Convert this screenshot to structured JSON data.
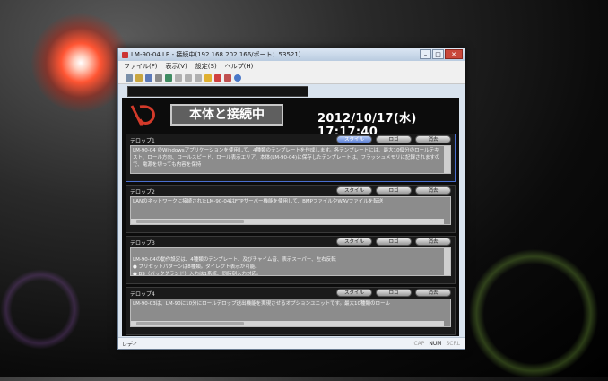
{
  "window": {
    "title": "LM-90-04 LE - 接続中(192.168.202.166/ポート：53521)",
    "buttons": {
      "minimize": "–",
      "maximize": "□",
      "close": "✕"
    }
  },
  "menu": [
    "ファイル(F)",
    "表示(V)",
    "設定(S)",
    "ヘルプ(H)"
  ],
  "toolbar_icons": [
    "new-icon",
    "open-icon",
    "save-icon",
    "print-icon",
    "cut-icon",
    "copy-icon",
    "paste-icon",
    "settings-icon",
    "send-icon",
    "stop-icon",
    "network-icon",
    "help-icon"
  ],
  "header": {
    "status": "本体と接続中",
    "datetime": "2012/10/17(水) 17:17:40"
  },
  "panels": [
    {
      "label": "テロップ1",
      "buttons": [
        "スタイル",
        "ロゴ",
        "消去"
      ],
      "text": "LM-90-04 のWindowsアプリケーションを使用して、4種類のテンプレートを作成します。各テンプレートには、最大10個分のロールテキスト、ロール方向、ロールスピード、ロール表示エリア、本体(LM-90-04)に保存したテンプレートは、フラッシュメモリに記録されますので、電源を切っても内容を保持"
    },
    {
      "label": "テロップ2",
      "buttons": [
        "スタイル",
        "ロゴ",
        "消去"
      ],
      "text": "LANのネットワークに接続されたLM-90-04はFTPサーバー機能を使用して、BMPファイルやWAVファイルを転送"
    },
    {
      "label": "テロップ3",
      "buttons": [
        "スタイル",
        "ロゴ",
        "消去"
      ],
      "text": "LM-90-04の動作設定は、4種類のテンプレート、及びチャイム音、表示スーパー、左右反転\n● プリセットパターンは8種類。ダイレクト表示が可能。\n● BS（バックグランド）入力は1系統、同時刻入力対応。"
    },
    {
      "label": "テロップ4",
      "buttons": [
        "スタイル",
        "ロゴ",
        "消去"
      ],
      "text": "LM-90-03は、LM-90に10分にロールテロップ送出機能を実現させるオプションユニットです。最大10種類のロール"
    }
  ],
  "statusbar": {
    "ready": "レディ",
    "indicators": [
      {
        "label": "CAP",
        "on": false
      },
      {
        "label": "NUM",
        "on": true
      },
      {
        "label": "SCRL",
        "on": false
      }
    ]
  },
  "colors": {
    "accent_blue": "#5d7fd4",
    "logo_red": "#d33a2a",
    "background": "#000000"
  }
}
